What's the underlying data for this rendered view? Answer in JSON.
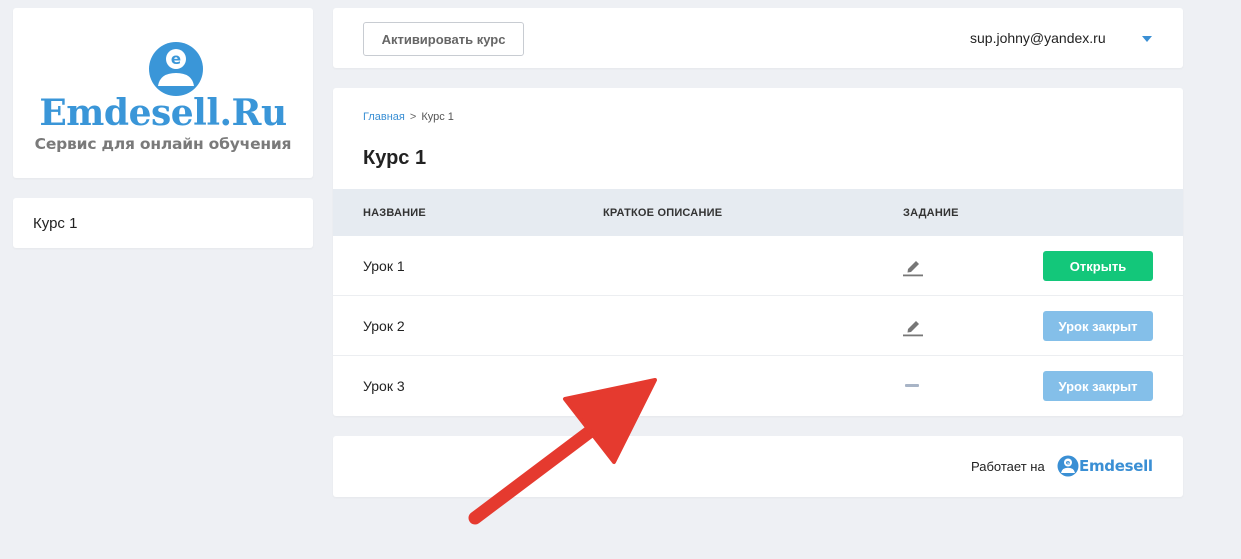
{
  "logo": {
    "title": "Emdesell.Ru",
    "subtitle": "Сервис для онлайн обучения",
    "icon": "emdesell-logo-icon",
    "brand_color": "#3a96d8"
  },
  "sidebar": {
    "items": [
      {
        "label": "Курс 1"
      }
    ]
  },
  "topbar": {
    "activate_label": "Активировать курс",
    "user_email": "sup.johny@yandex.ru",
    "caret_icon": "caret-down-icon"
  },
  "breadcrumb": {
    "home": "Главная",
    "separator": ">",
    "current": "Курс 1"
  },
  "page": {
    "title": "Курс 1"
  },
  "table": {
    "headers": {
      "name": "НАЗВАНИЕ",
      "description": "КРАТКОЕ ОПИСАНИЕ",
      "task": "ЗАДАНИЕ"
    },
    "rows": [
      {
        "name": "Урок 1",
        "description": "",
        "task_icon": "pencil-icon",
        "action": "Открыть",
        "action_state": "open"
      },
      {
        "name": "Урок 2",
        "description": "",
        "task_icon": "pencil-icon",
        "action": "Урок закрыт",
        "action_state": "closed"
      },
      {
        "name": "Урок 3",
        "description": "",
        "task_icon": "dash-icon",
        "action": "Урок закрыт",
        "action_state": "closed"
      }
    ]
  },
  "footer": {
    "powered_by": "Работает на",
    "brand": "Emdesell"
  },
  "colors": {
    "open_button": "#13c77a",
    "closed_button": "#84bfe9",
    "accent": "#3a8fd4",
    "annotation_arrow": "#e53a2f"
  }
}
